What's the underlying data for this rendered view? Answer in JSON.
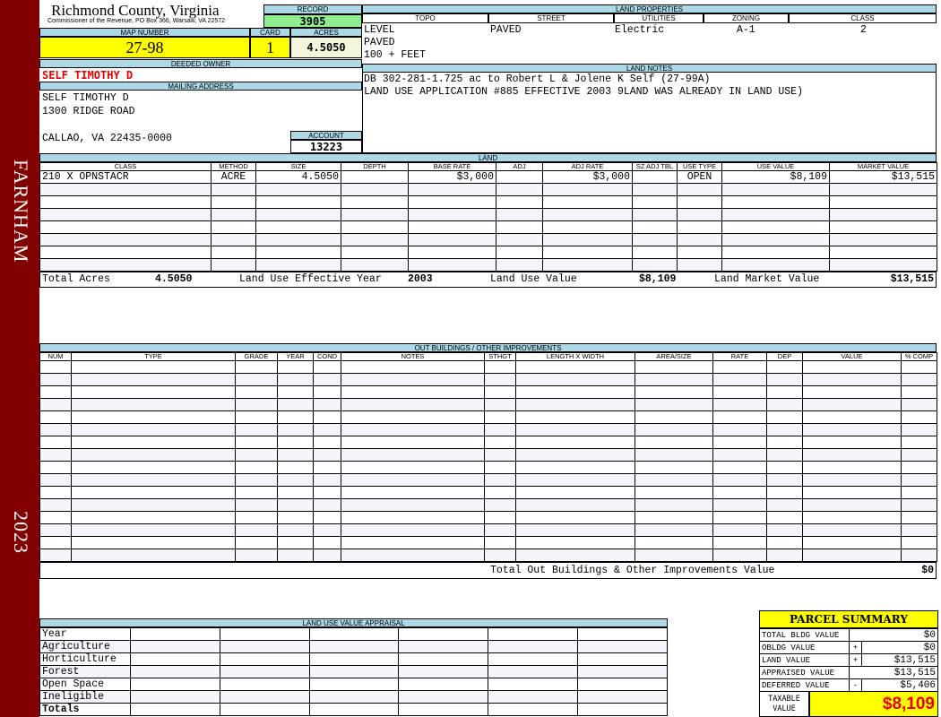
{
  "sidebar": {
    "district": "FARNHAM",
    "year": "2023",
    "color": "#800000"
  },
  "header": {
    "county": "Richmond County, Virginia",
    "address": "Commissioner of the Revenue, PO Box 366, Warsaw, VA 22572"
  },
  "record": {
    "label": "RECORD",
    "value": "3905"
  },
  "map": {
    "label": "MAP NUMBER",
    "value": "27-98"
  },
  "card": {
    "label": "CARD",
    "value": "1"
  },
  "acres": {
    "label": "ACRES",
    "value": "4.5050"
  },
  "owner": {
    "label": "DEEDED OWNER",
    "value": "SELF TIMOTHY D"
  },
  "mailing": {
    "label": "MAILING ADDRESS",
    "line1": "SELF TIMOTHY D",
    "line2": "1300 RIDGE ROAD",
    "line3": "CALLAO, VA 22435-0000"
  },
  "account": {
    "label": "ACCOUNT",
    "value": "13223"
  },
  "land_properties": {
    "title": "LAND PROPERTIES",
    "headers": [
      "TOPO",
      "STREET",
      "UTILITIES",
      "ZONING",
      "CLASS"
    ],
    "topo": [
      "LEVEL",
      "PAVED",
      "100 + FEET"
    ],
    "street": "PAVED",
    "utilities": "Electric",
    "zoning": "A-1",
    "class": "2"
  },
  "land_notes": {
    "title": "LAND NOTES",
    "lines": [
      "DB 302-281-1.725 ac to Robert L & Jolene K Self (27-99A)",
      "LAND USE APPLICATION #885 EFFECTIVE 2003 9LAND WAS ALREADY IN LAND USE)"
    ]
  },
  "land": {
    "title": "LAND",
    "headers": [
      "CLASS",
      "METHOD",
      "SIZE",
      "DEPTH",
      "BASE RATE",
      "ADJ",
      "ADJ RATE",
      "SZ ADJ TBL",
      "USE TYPE",
      "USE VALUE",
      "MARKET VALUE"
    ],
    "rows": [
      [
        "210 X OPNSTACR",
        "ACRE",
        "4.5050",
        "",
        "$3,000",
        "",
        "$3,000",
        "",
        "OPEN",
        "$8,109",
        "$13,515"
      ]
    ],
    "totals": {
      "acres_label": "Total Acres",
      "acres": "4.5050",
      "year_label": "Land Use Effective Year",
      "year": "2003",
      "use_label": "Land Use Value",
      "use": "$8,109",
      "market_label": "Land Market Value",
      "market": "$13,515"
    }
  },
  "outbuildings": {
    "title": "OUT BUILDINGS / OTHER IMPROVEMENTS",
    "headers": [
      "NUM",
      "TYPE",
      "GRADE",
      "YEAR",
      "COND",
      "NOTES",
      "STHGT",
      "LENGTH X WIDTH",
      "AREA/SIZE",
      "RATE",
      "DEP",
      "VALUE",
      "% COMP"
    ],
    "total_label": "Total Out Buildings & Other Improvements Value",
    "total": "$0"
  },
  "land_use": {
    "title": "LAND USE VALUE APPRAISAL",
    "rows": [
      "Year",
      "Agriculture",
      "Horticulture",
      "Forest",
      "Open Space",
      "Ineligible",
      "Totals"
    ]
  },
  "summary": {
    "title": "PARCEL SUMMARY",
    "rows": [
      {
        "label": "TOTAL BLDG VALUE",
        "op": "",
        "value": "$0"
      },
      {
        "label": "OBLDG VALUE",
        "op": "+",
        "value": "$0"
      },
      {
        "label": "LAND VALUE",
        "op": "+",
        "value": "$13,515"
      },
      {
        "label": "APPRAISED VALUE",
        "op": "",
        "value": "$13,515"
      },
      {
        "label": "DEFERRED VALUE",
        "op": "-",
        "value": "$5,406"
      }
    ],
    "taxable_label": "TAXABLE VALUE",
    "taxable": "$8,109"
  }
}
